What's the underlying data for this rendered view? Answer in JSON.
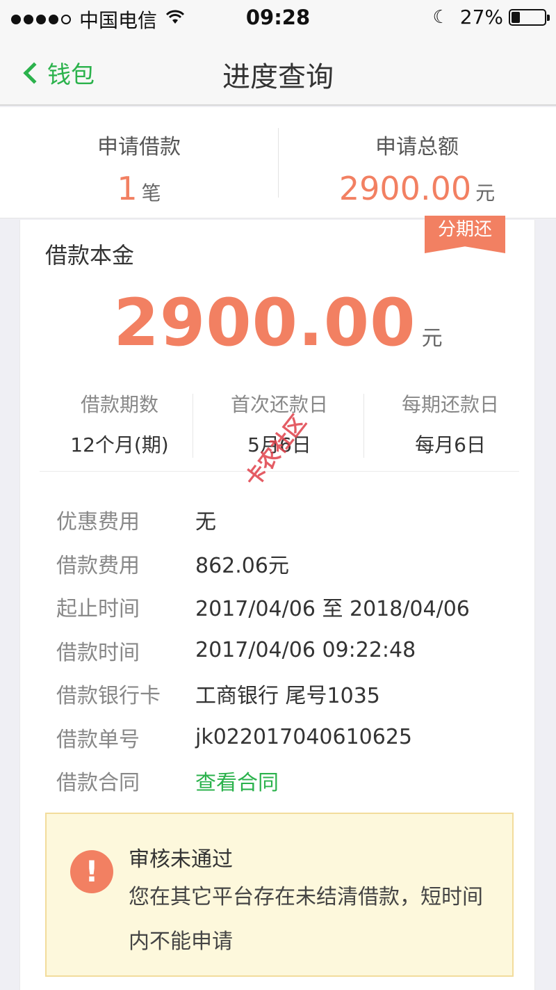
{
  "status_bar": {
    "carrier": "中国电信",
    "time": "09:28",
    "battery_percent": "27%",
    "battery_level": 0.27,
    "icons": [
      "signal-dots-icon",
      "wifi-icon",
      "moon-icon",
      "battery-icon"
    ]
  },
  "nav": {
    "back_label": "钱包",
    "title": "进度查询",
    "accent_color": "#2bb24c"
  },
  "summary": {
    "count_label": "申请借款",
    "count_value": "1",
    "count_unit": "笔",
    "total_label": "申请总额",
    "total_value": "2900.00",
    "total_unit": "元",
    "highlight_color": "#f28062"
  },
  "loan": {
    "tag": "分期还",
    "principal_label": "借款本金",
    "principal_amount": "2900.00",
    "principal_unit": "元",
    "terms": [
      {
        "label": "借款期数",
        "value": "12个月(期)"
      },
      {
        "label": "首次还款日",
        "value": "5月6日"
      },
      {
        "label": "每期还款日",
        "value": "每月6日"
      }
    ],
    "details": [
      {
        "label": "优惠费用",
        "value": "无"
      },
      {
        "label": "借款费用",
        "value": "862.06元"
      },
      {
        "label": "起止时间",
        "value": "2017/04/06 至 2018/04/06"
      },
      {
        "label": "借款时间",
        "value": "2017/04/06 09:22:48"
      },
      {
        "label": "借款银行卡",
        "value": "工商银行 尾号1035"
      },
      {
        "label": "借款单号",
        "value": "jk022017040610625"
      },
      {
        "label": "借款合同",
        "value": "查看合同"
      }
    ]
  },
  "alert": {
    "icon_glyph": "!",
    "title": "审核未通过",
    "message": "您在其它平台存在未结清借款，短时间内不能申请"
  },
  "watermark": "卡农社区"
}
